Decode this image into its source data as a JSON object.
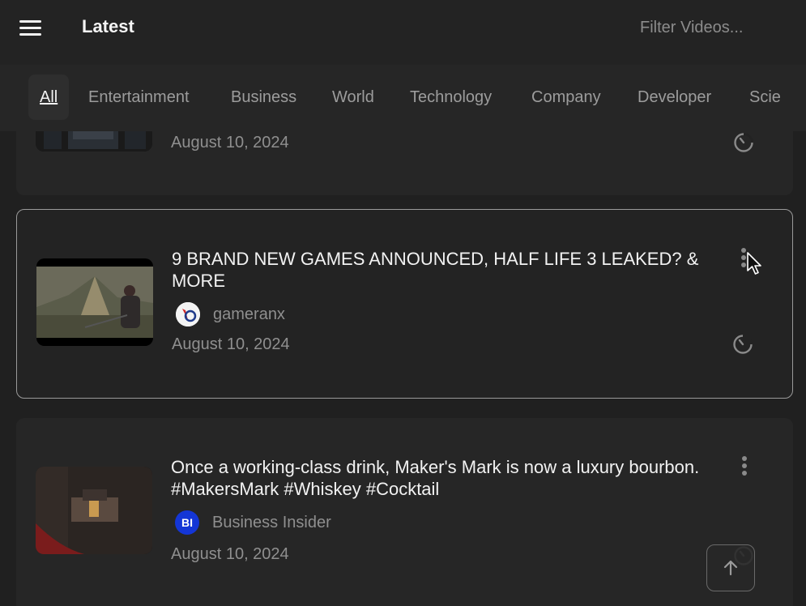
{
  "header": {
    "title": "Latest",
    "filter_placeholder": "Filter Videos..."
  },
  "tabs": [
    {
      "label": "All",
      "active": true
    },
    {
      "label": "Entertainment",
      "active": false
    },
    {
      "label": "Business",
      "active": false
    },
    {
      "label": "World",
      "active": false
    },
    {
      "label": "Technology",
      "active": false
    },
    {
      "label": "Company",
      "active": false
    },
    {
      "label": "Developer",
      "active": false
    },
    {
      "label": "Scie",
      "active": false
    }
  ],
  "videos": [
    {
      "title": "",
      "channel": "",
      "date": "August 10, 2024"
    },
    {
      "title": "9 BRAND NEW GAMES ANNOUNCED, HALF LIFE 3 LEAKED? & MORE",
      "channel": "gameranx",
      "avatar_text": "G",
      "date": "August 10, 2024",
      "selected": true
    },
    {
      "title": "Once a working-class drink, Maker's Mark is now a luxury bourbon. #MakersMark #Whiskey #Cocktail",
      "channel": "Business Insider",
      "avatar_text": "BI",
      "date": "August 10, 2024"
    }
  ],
  "icons": {
    "menu": "hamburger-icon",
    "more": "more-vertical-icon",
    "watch_later": "timer-icon",
    "scroll_top": "arrow-up-icon"
  },
  "colors": {
    "background": "#202020",
    "header": "#232323",
    "card": "#262626",
    "selected_border": "#9a9a9a",
    "bi_avatar": "#1436d6"
  }
}
